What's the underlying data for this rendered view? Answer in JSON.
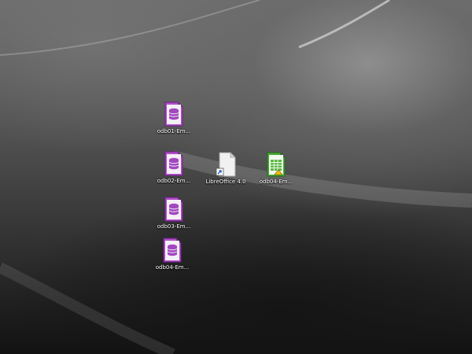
{
  "desktop": {
    "icons": [
      {
        "label": "odb01-Em...",
        "icon": "libreoffice-base-icon"
      },
      {
        "label": "odb02-Em...",
        "icon": "libreoffice-base-icon"
      },
      {
        "label": "LibreOffice 4.0",
        "icon": "blank-document-shortcut-icon"
      },
      {
        "label": "odb04-Em...",
        "icon": "libreoffice-calc-icon"
      },
      {
        "label": "odb03-Em...",
        "icon": "libreoffice-base-icon"
      },
      {
        "label": "odb04-Em...",
        "icon": "libreoffice-base-icon"
      }
    ]
  },
  "colors": {
    "base_accent": "#9c3fb4",
    "calc_accent": "#3a9a2a",
    "label_text": "#ffffff"
  }
}
